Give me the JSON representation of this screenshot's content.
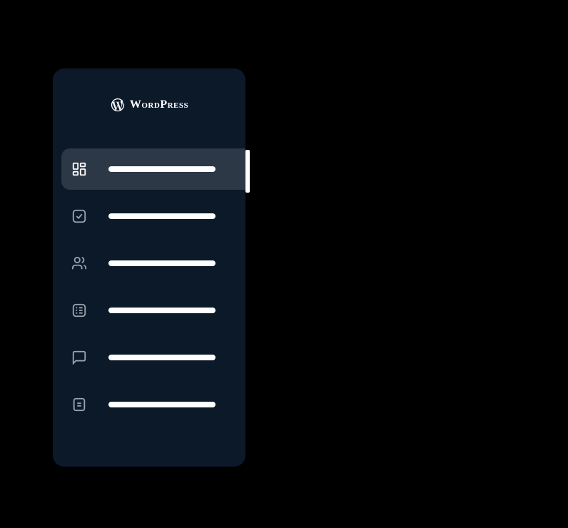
{
  "logo": {
    "text": "WordPress"
  },
  "sidebar": {
    "items": [
      {
        "icon": "dashboard",
        "active": true
      },
      {
        "icon": "checkbox",
        "active": false
      },
      {
        "icon": "users",
        "active": false
      },
      {
        "icon": "list-check",
        "active": false
      },
      {
        "icon": "comment",
        "active": false
      },
      {
        "icon": "document",
        "active": false
      }
    ]
  }
}
